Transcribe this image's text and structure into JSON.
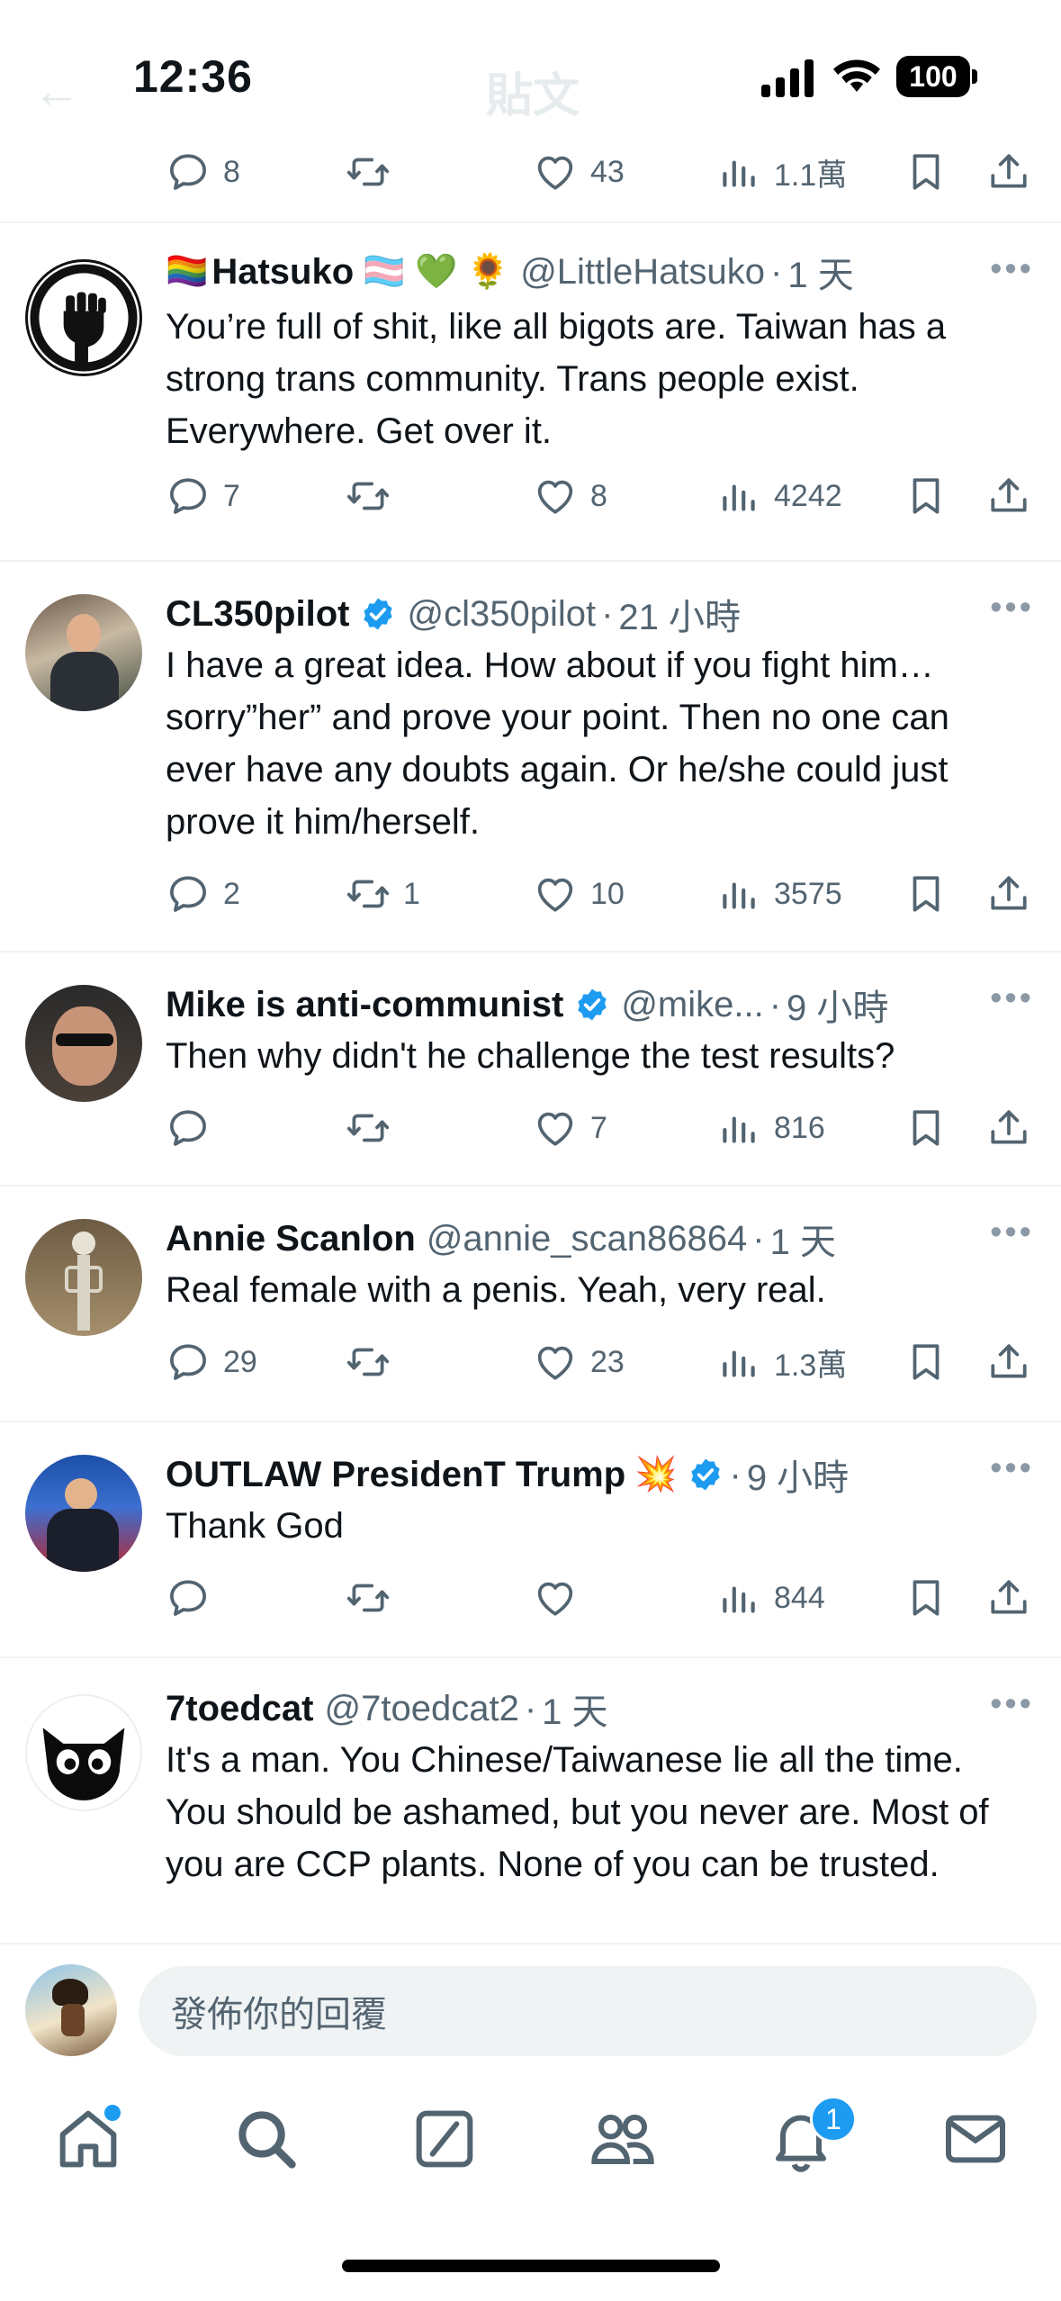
{
  "status_bar": {
    "time": "12:36",
    "battery": "100"
  },
  "header_blurred_title": "貼文",
  "top_tweet_actions": {
    "replies": "8",
    "retweets": "",
    "likes": "43",
    "views": "1.1萬"
  },
  "tweets": [
    {
      "name": "Hatsuko",
      "name_prefix_emoji": "🏳️‍🌈",
      "name_suffix_emoji": "🏳️‍⚧️ 💚 🌻",
      "handle": "@LittleHatsuko",
      "age": "1 天",
      "verified": false,
      "text": "You’re full of shit, like all bigots are. Taiwan has a strong trans community. Trans people exist. Everywhere. Get over it.",
      "replies": "7",
      "retweets": "",
      "likes": "8",
      "views": "4242"
    },
    {
      "name": "CL350pilot",
      "handle": "@cl350pilot",
      "age": "21 小時",
      "verified": true,
      "text": "I have a great idea.  How about if you fight him… sorry”her” and prove your point.  Then no one can ever have any doubts again.  Or he/she could just prove it him/herself.",
      "replies": "2",
      "retweets": "1",
      "likes": "10",
      "views": "3575"
    },
    {
      "name": "Mike is anti-communist",
      "handle": "@mike...",
      "age": "9 小時",
      "verified": true,
      "text": "Then why didn't he challenge the test results?",
      "replies": "",
      "retweets": "",
      "likes": "7",
      "views": "816"
    },
    {
      "name": "Annie Scanlon",
      "handle": "@annie_scan86864",
      "age": "1 天",
      "verified": false,
      "text": "Real female with a penis. Yeah, very real.",
      "replies": "29",
      "retweets": "",
      "likes": "23",
      "views": "1.3萬"
    },
    {
      "name": "OUTLAW PresidenT Trump",
      "name_suffix_emoji": "💥",
      "handle": "",
      "age": "9 小時",
      "verified": true,
      "text": "Thank God",
      "replies": "",
      "retweets": "",
      "likes": "",
      "views": "844"
    },
    {
      "name": "7toedcat",
      "handle": "@7toedcat2",
      "age": "1 天",
      "verified": false,
      "text": "It's a man. You Chinese/Taiwanese lie all the time. You should be ashamed, but you never are. Most of you are CCP plants. None of you can be trusted."
    }
  ],
  "composer": {
    "placeholder": "發佈你的回覆"
  },
  "tabbar": {
    "notifications_badge": "1"
  },
  "colors": {
    "accent": "#1d9bf0",
    "text": "#0f1419",
    "secondary": "#536471",
    "divider": "#eff3f4"
  }
}
